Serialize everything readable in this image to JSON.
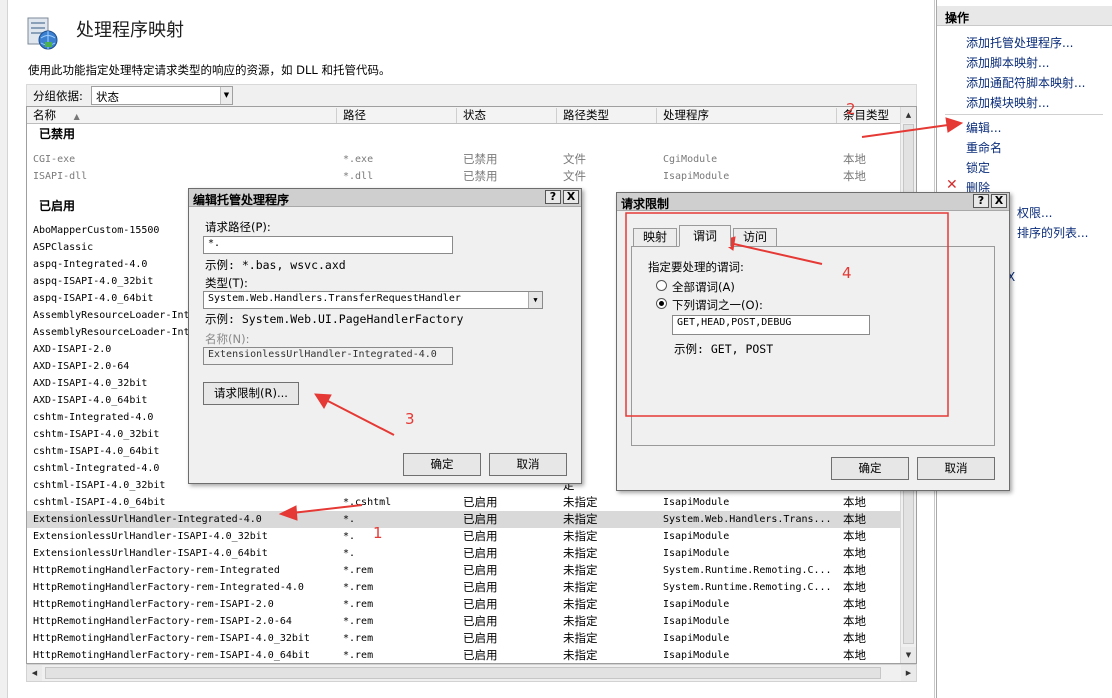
{
  "header": {
    "title": "处理程序映射",
    "description": "使用此功能指定处理特定请求类型的响应的资源，如 DLL 和托管代码。",
    "group_label": "分组依据:",
    "group_value": "状态"
  },
  "columns": [
    "名称",
    "路径",
    "状态",
    "路径类型",
    "处理程序",
    "条目类型"
  ],
  "disabled_group": "已禁用",
  "enabled_group": "已启用",
  "disabled_rows": [
    [
      "CGI-exe",
      "*.exe",
      "已禁用",
      "文件",
      "CgiModule",
      "本地"
    ],
    [
      "ISAPI-dll",
      "*.dll",
      "已禁用",
      "文件",
      "IsapiModule",
      "本地"
    ]
  ],
  "enabled_rows": [
    [
      "AboMapperCustom-15500",
      "",
      "",
      "",
      "",
      ""
    ],
    [
      "ASPClassic",
      "",
      "",
      "",
      "",
      ""
    ],
    [
      "aspq-Integrated-4.0",
      "",
      "",
      "定",
      "",
      ""
    ],
    [
      "aspq-ISAPI-4.0_32bit",
      "",
      "",
      "定",
      "",
      ""
    ],
    [
      "aspq-ISAPI-4.0_64bit",
      "",
      "",
      "定",
      "",
      ""
    ],
    [
      "AssemblyResourceLoader-Int",
      "",
      "",
      "定",
      "",
      ""
    ],
    [
      "AssemblyResourceLoader-Int",
      "",
      "",
      "定",
      "",
      ""
    ],
    [
      "AXD-ISAPI-2.0",
      "",
      "",
      "定",
      "",
      ""
    ],
    [
      "AXD-ISAPI-2.0-64",
      "",
      "",
      "定",
      "",
      ""
    ],
    [
      "AXD-ISAPI-4.0_32bit",
      "",
      "",
      "定",
      "",
      ""
    ],
    [
      "AXD-ISAPI-4.0_64bit",
      "",
      "",
      "定",
      "",
      ""
    ],
    [
      "cshtm-Integrated-4.0",
      "",
      "",
      "定",
      "",
      ""
    ],
    [
      "cshtm-ISAPI-4.0_32bit",
      "",
      "",
      "定",
      "",
      ""
    ],
    [
      "cshtm-ISAPI-4.0_64bit",
      "",
      "",
      "定",
      "",
      ""
    ],
    [
      "cshtml-Integrated-4.0",
      "",
      "",
      "定",
      "",
      ""
    ],
    [
      "cshtml-ISAPI-4.0_32bit",
      "",
      "",
      "定",
      "",
      ""
    ],
    [
      "cshtml-ISAPI-4.0_64bit",
      "*.cshtml",
      "已启用",
      "未指定",
      "IsapiModule",
      "本地"
    ],
    [
      "ExtensionlessUrlHandler-Integrated-4.0",
      "*.",
      "已启用",
      "未指定",
      "System.Web.Handlers.Trans...",
      "本地"
    ],
    [
      "ExtensionlessUrlHandler-ISAPI-4.0_32bit",
      "*.",
      "已启用",
      "未指定",
      "IsapiModule",
      "本地"
    ],
    [
      "ExtensionlessUrlHandler-ISAPI-4.0_64bit",
      "*.",
      "已启用",
      "未指定",
      "IsapiModule",
      "本地"
    ],
    [
      "HttpRemotingHandlerFactory-rem-Integrated",
      "*.rem",
      "已启用",
      "未指定",
      "System.Runtime.Remoting.C...",
      "本地"
    ],
    [
      "HttpRemotingHandlerFactory-rem-Integrated-4.0",
      "*.rem",
      "已启用",
      "未指定",
      "System.Runtime.Remoting.C...",
      "本地"
    ],
    [
      "HttpRemotingHandlerFactory-rem-ISAPI-2.0",
      "*.rem",
      "已启用",
      "未指定",
      "IsapiModule",
      "本地"
    ],
    [
      "HttpRemotingHandlerFactory-rem-ISAPI-2.0-64",
      "*.rem",
      "已启用",
      "未指定",
      "IsapiModule",
      "本地"
    ],
    [
      "HttpRemotingHandlerFactory-rem-ISAPI-4.0_32bit",
      "*.rem",
      "已启用",
      "未指定",
      "IsapiModule",
      "本地"
    ],
    [
      "HttpRemotingHandlerFactory-rem-ISAPI-4.0_64bit",
      "*.rem",
      "已启用",
      "未指定",
      "IsapiModule",
      "本地"
    ]
  ],
  "actions": {
    "title": "操作",
    "add_managed": "添加托管处理程序...",
    "add_script": "添加脚本映射...",
    "add_wildcard": "添加通配符脚本映射...",
    "add_module": "添加模块映射...",
    "edit": "编辑...",
    "rename": "重命名",
    "lock": "锁定",
    "delete": "删除",
    "permissions": "权限...",
    "ordered_list": "排序的列表...",
    "partial_x": "X"
  },
  "edit_dialog": {
    "title": "编辑托管处理程序",
    "help": "?",
    "close": "X",
    "path_label": "请求路径(P):",
    "path_value": "*.",
    "path_example": "示例: *.bas, wsvc.axd",
    "type_label": "类型(T):",
    "type_value": "System.Web.Handlers.TransferRequestHandler",
    "type_example": "示例: System.Web.UI.PageHandlerFactory",
    "name_label": "名称(N):",
    "name_value": "ExtensionlessUrlHandler-Integrated-4.0",
    "restrictions_button": "请求限制(R)...",
    "ok": "确定",
    "cancel": "取消"
  },
  "restrict_dialog": {
    "title": "请求限制",
    "help": "?",
    "close": "X",
    "tabs": [
      "映射",
      "谓词",
      "访问"
    ],
    "verbs_label": "指定要处理的谓词:",
    "all_verbs": "全部谓词(A)",
    "one_of": "下列谓词之一(O):",
    "verbs_value": "GET,HEAD,POST,DEBUG",
    "example": "示例: GET, POST",
    "ok": "确定",
    "cancel": "取消"
  },
  "annotations": [
    "1",
    "2",
    "3",
    "4"
  ],
  "colors": {
    "annotation": "#e53935",
    "link": "#0a2c7a",
    "selected_row": "#d9d9d9"
  }
}
